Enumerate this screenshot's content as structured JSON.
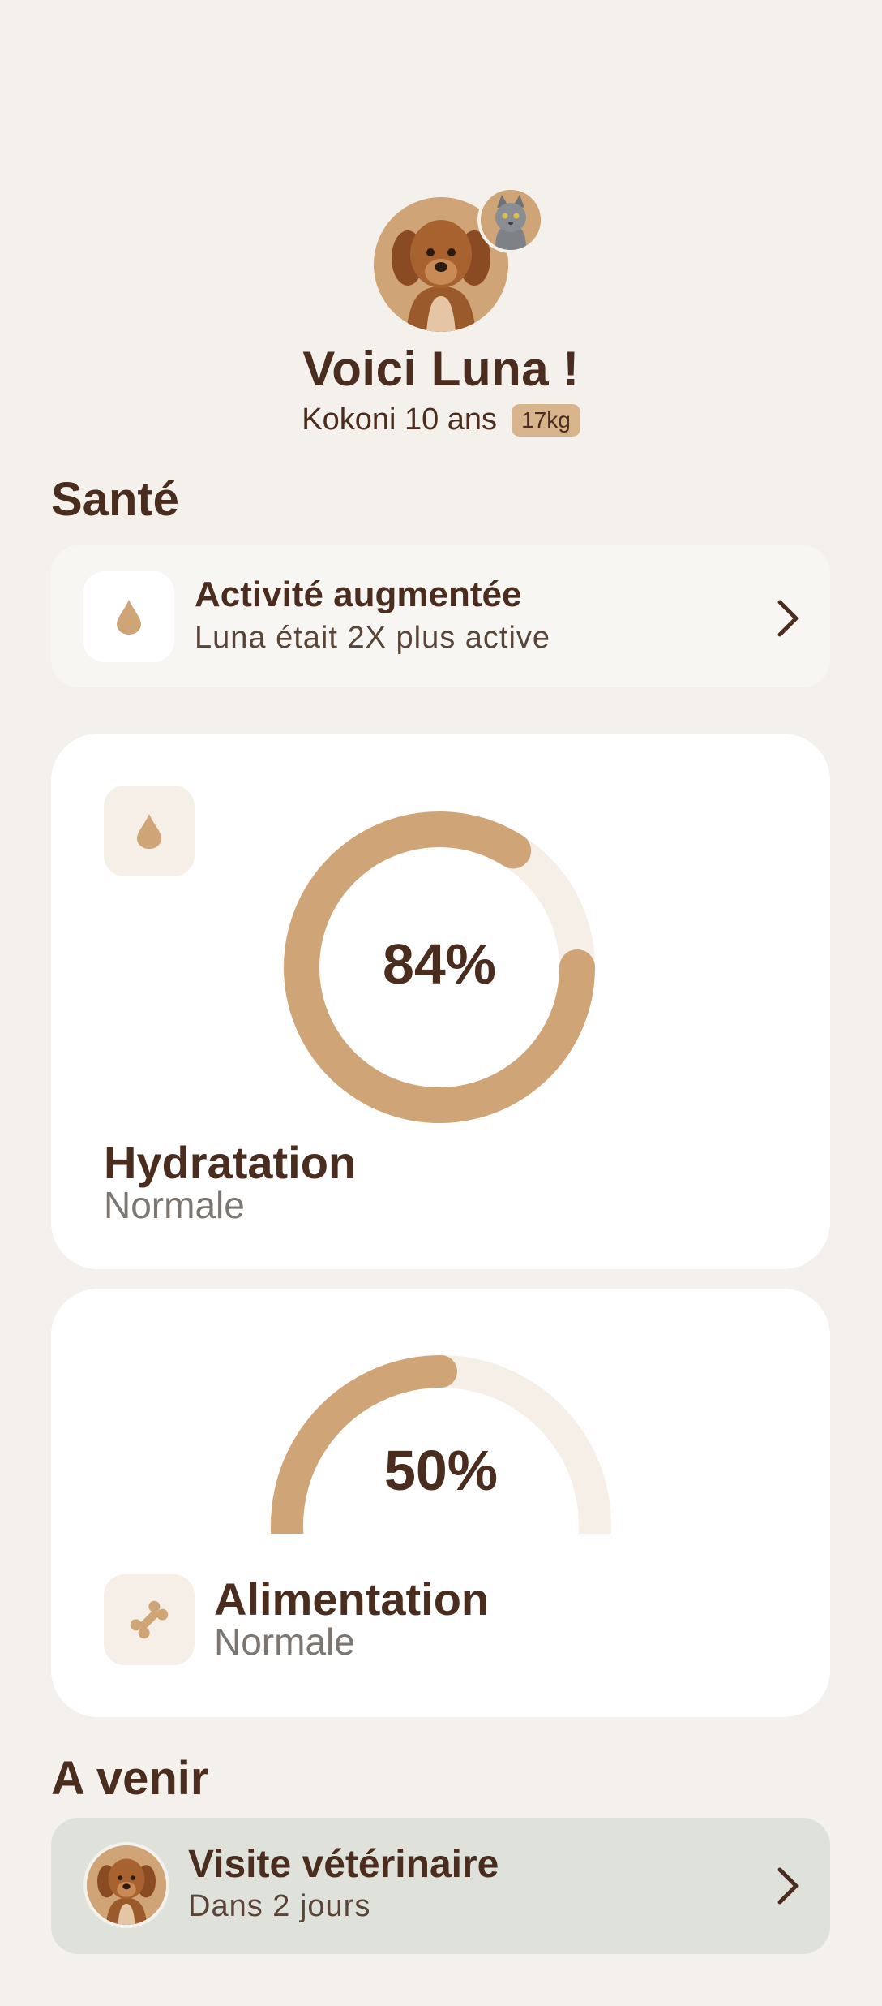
{
  "profile": {
    "main_avatar_icon": "dog-photo",
    "secondary_avatar_icon": "cat-photo",
    "title": "Voici Luna !",
    "subtitle": "Kokoni 10 ans",
    "weight": "17kg"
  },
  "health": {
    "section_title": "Santé",
    "alert": {
      "icon": "drop-icon",
      "title": "Activité augmentée",
      "subtitle": "Luna était 2X plus active"
    },
    "hydration": {
      "icon": "drop-icon",
      "value": "84%",
      "fraction": 0.84,
      "title": "Hydratation",
      "status": "Normale"
    },
    "feeding": {
      "icon": "bone-icon",
      "value": "50%",
      "fraction": 0.5,
      "title": "Alimentation",
      "status": "Normale"
    }
  },
  "upcoming": {
    "section_title": "A venir",
    "item": {
      "avatar_icon": "dog-photo",
      "title": "Visite vétérinaire",
      "subtitle": "Dans 2 jours"
    }
  },
  "colors": {
    "background": "#f4f1ec",
    "accent": "#cfa476",
    "text": "#4a2d1f",
    "track": "#f6efe7",
    "upcoming_bg": "#dfe2da"
  }
}
